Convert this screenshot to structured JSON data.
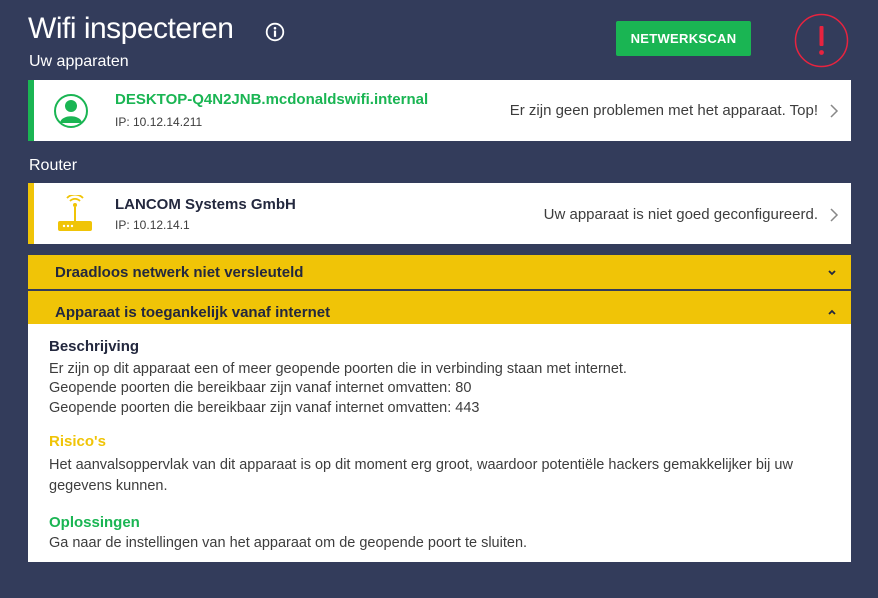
{
  "header": {
    "title": "Wifi inspecteren",
    "scan_button": "NETWERKSCAN"
  },
  "sections": {
    "devices_label": "Uw apparaten",
    "router_label": "Router"
  },
  "device": {
    "name": "DESKTOP-Q4N2JNB.mcdonaldswifi.internal",
    "ip": "IP: 10.12.14.211",
    "status": "Er zijn geen problemen met het apparaat. Top!"
  },
  "router": {
    "name": "LANCOM Systems GmbH",
    "ip": "IP: 10.12.14.1",
    "status": "Uw apparaat is niet goed geconfigureerd."
  },
  "issues": [
    {
      "label": "Draadloos netwerk niet versleuteld",
      "expanded": false
    },
    {
      "label": "Apparaat is toegankelijk vanaf internet",
      "expanded": true
    }
  ],
  "details": {
    "description_heading": "Beschrijving",
    "description_lines": [
      "Er zijn op dit apparaat een of meer geopende poorten die in verbinding staan met internet.",
      "Geopende poorten die bereikbaar zijn vanaf internet omvatten: 80",
      "Geopende poorten die bereikbaar zijn vanaf internet omvatten: 443"
    ],
    "risks_heading": "Risico's",
    "risks_text": "Het aanvalsoppervlak van dit apparaat is op dit moment erg groot, waardoor potentiële hackers gemakkelijker bij uw gegevens kunnen.",
    "solutions_heading": "Oplossingen",
    "solutions_text": "Ga naar de instellingen van het apparaat om de geopende poort te sluiten."
  },
  "colors": {
    "background": "#333c5b",
    "green": "#1ab553",
    "yellow": "#f0c407",
    "alert_red": "#e8233f"
  },
  "icons": {
    "info": "info-icon",
    "alert": "alert-icon",
    "device": "user-icon",
    "router": "router-icon",
    "chevron_right": "chevron-right-icon",
    "chevron_down": "chevron-down-icon",
    "chevron_up": "chevron-up-icon"
  }
}
